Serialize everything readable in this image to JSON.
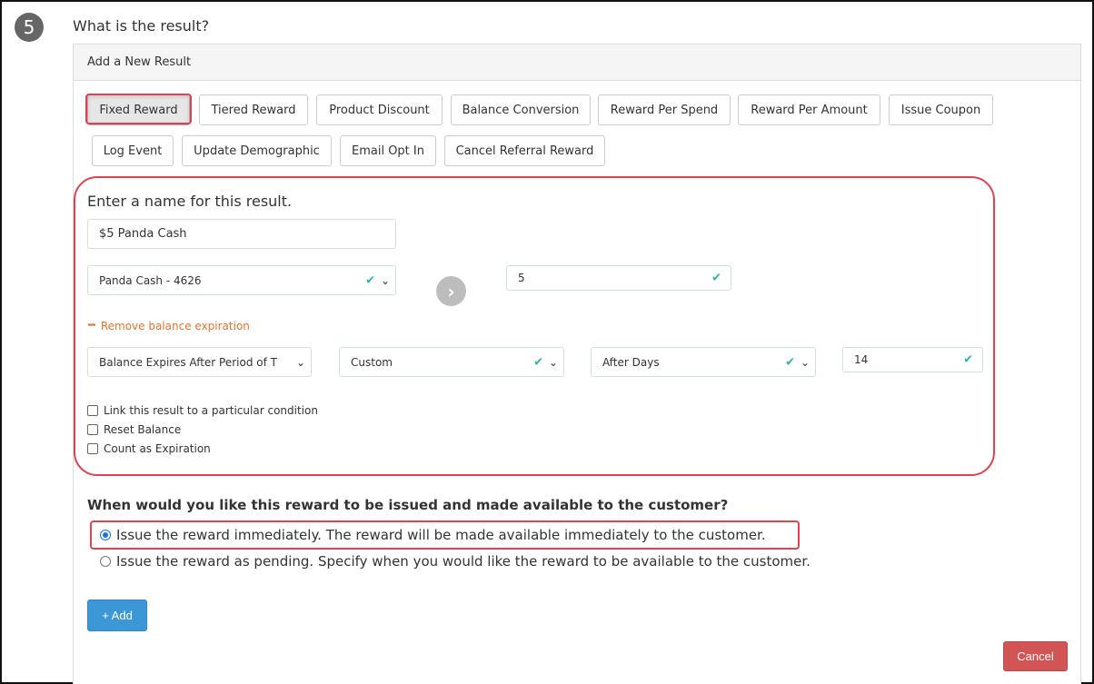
{
  "step": {
    "number": "5",
    "question": "What is the result?"
  },
  "panel": {
    "title": "Add a New Result"
  },
  "result_types": [
    "Fixed Reward",
    "Tiered Reward",
    "Product Discount",
    "Balance Conversion",
    "Reward Per Spend",
    "Reward Per Amount",
    "Issue Coupon",
    "Log Event",
    "Update Demographic",
    "Email Opt In",
    "Cancel Referral Reward"
  ],
  "active_type": "Fixed Reward",
  "form": {
    "name_label": "Enter a name for this result.",
    "name_value": "$5 Panda Cash",
    "balance_select": "Panda Cash - 4626",
    "amount_value": "5",
    "remove_expiration_label": "Remove balance expiration",
    "expiry_type_select": "Balance Expires After Period of Ti",
    "period_select": "Custom",
    "after_select": "After Days",
    "days_value": "14",
    "checkboxes": {
      "link_condition": "Link this result to a particular condition",
      "reset_balance": "Reset Balance",
      "count_expiration": "Count as Expiration"
    }
  },
  "issue": {
    "question": "When would you like this reward to be issued and made available to the customer?",
    "option_immediate": "Issue the reward immediately. The reward will be made available immediately to the customer.",
    "option_pending": "Issue the reward as pending. Specify when you would like the reward to be available to the customer.",
    "selected": "immediate"
  },
  "buttons": {
    "add": "+ Add",
    "cancel": "Cancel"
  },
  "icons": {
    "check": "check-icon",
    "chevron": "chevron-down-icon",
    "arrow": "arrow-right-circle-icon",
    "minus": "minus-icon"
  },
  "colors": {
    "highlight": "#e0434f",
    "primary": "#3c97d6",
    "danger": "#d35454",
    "link": "#e8732c",
    "check": "#2cb5a0"
  }
}
